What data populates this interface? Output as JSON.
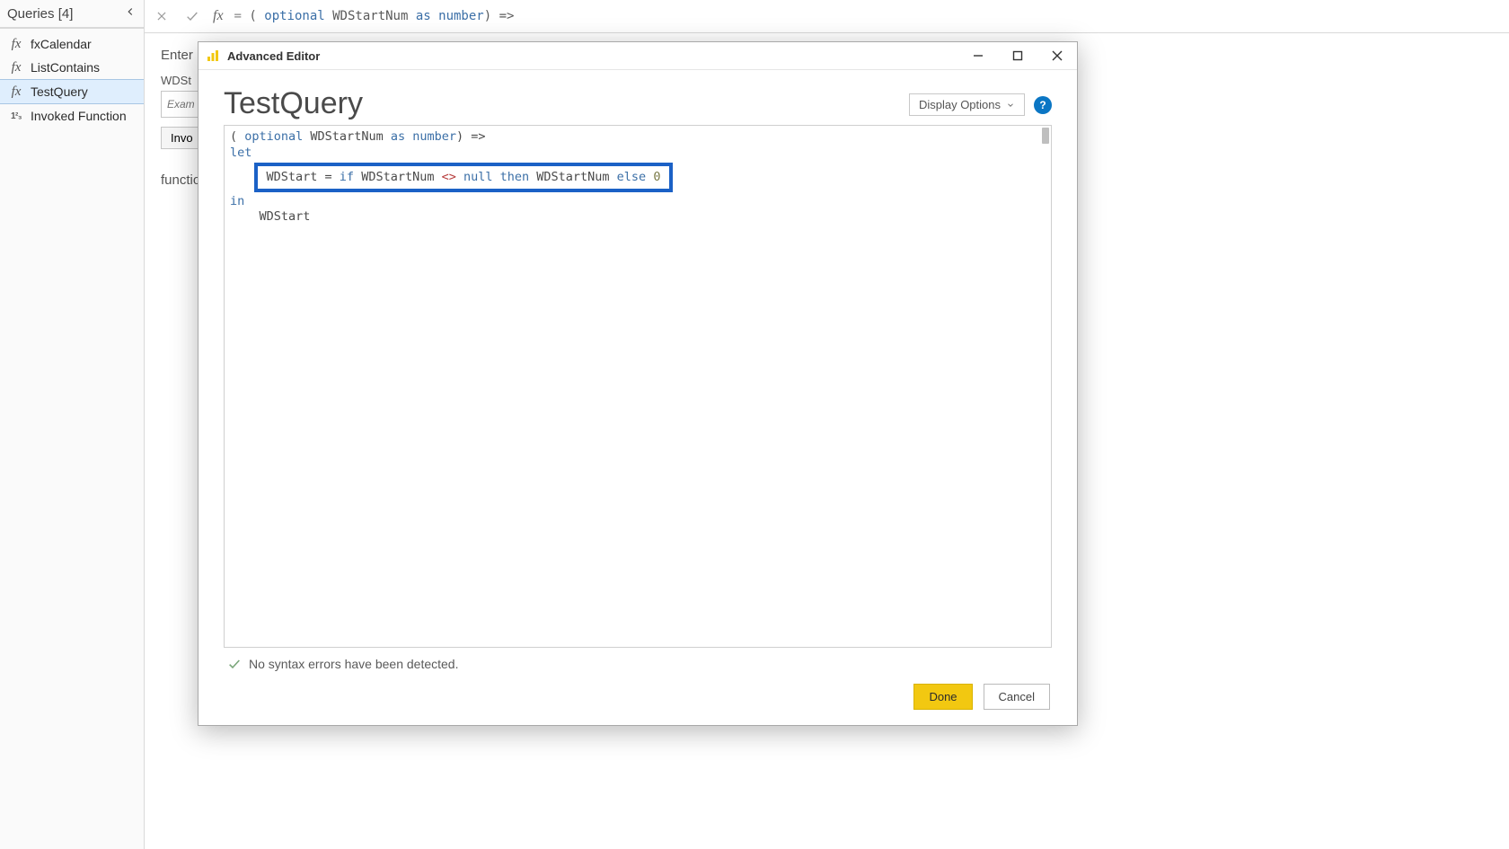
{
  "sidebar": {
    "header": "Queries [4]",
    "items": [
      {
        "icon": "fx",
        "label": "fxCalendar"
      },
      {
        "icon": "fx",
        "label": "ListContains"
      },
      {
        "icon": "fx",
        "label": "TestQuery",
        "selected": true
      },
      {
        "icon": "num",
        "label": "Invoked Function"
      }
    ]
  },
  "formula_bar": {
    "eq": "= ",
    "p_open": "( ",
    "kw_optional": "optional ",
    "ident": "WDStartNum ",
    "kw_as": "as ",
    "kw_number": "number",
    "p_close": ") =>"
  },
  "background": {
    "enter_label": "Enter",
    "field_label": "WDSt",
    "placeholder": "Exam",
    "invoke_button": "Invo",
    "function_label": "functio"
  },
  "modal": {
    "title": "Advanced Editor",
    "query_name": "TestQuery",
    "display_options": "Display Options",
    "code": {
      "line1_p": "( ",
      "line1_kw_optional": "optional ",
      "line1_ident": "WDStartNum ",
      "line1_kw_as": "as ",
      "line1_kw_number": "number",
      "line1_close": ") =>",
      "line2_let": "let",
      "line3_lhs": "WDStart = ",
      "line3_if": "if ",
      "line3_id1": "WDStartNum ",
      "line3_neq": "<> ",
      "line3_null": "null ",
      "line3_then": "then ",
      "line3_id2": "WDStartNum ",
      "line3_else": "else ",
      "line3_zero": "0",
      "line4_in": "in",
      "line5": "    WDStart"
    },
    "status": "No syntax errors have been detected.",
    "done_button": "Done",
    "cancel_button": "Cancel"
  }
}
